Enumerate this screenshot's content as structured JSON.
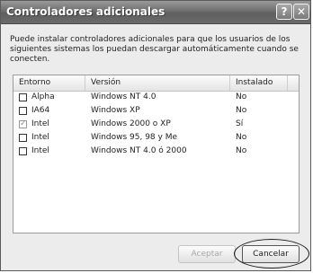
{
  "window": {
    "title": "Controladores adicionales",
    "help_glyph": "?",
    "close_glyph": "✕"
  },
  "intro_text": "Puede instalar controladores adicionales para que los usuarios de los siguientes sistemas los puedan descargar automáticamente cuando se conecten.",
  "list": {
    "headers": [
      "Entorno",
      "Versión",
      "Instalado"
    ],
    "rows": [
      {
        "checked": false,
        "entorno": "Alpha",
        "version": "Windows NT 4.0",
        "instalado": "No"
      },
      {
        "checked": false,
        "entorno": "IA64",
        "version": "Windows XP",
        "instalado": "No"
      },
      {
        "checked": true,
        "entorno": "Intel",
        "version": "Windows 2000 o XP",
        "instalado": "Sí"
      },
      {
        "checked": false,
        "entorno": "Intel",
        "version": "Windows 95, 98 y Me",
        "instalado": "No"
      },
      {
        "checked": false,
        "entorno": "Intel",
        "version": "Windows NT 4.0 ó 2000",
        "instalado": "No"
      }
    ]
  },
  "buttons": {
    "accept_label": "Aceptar",
    "accept_enabled": false,
    "cancel_label": "Cancelar"
  }
}
